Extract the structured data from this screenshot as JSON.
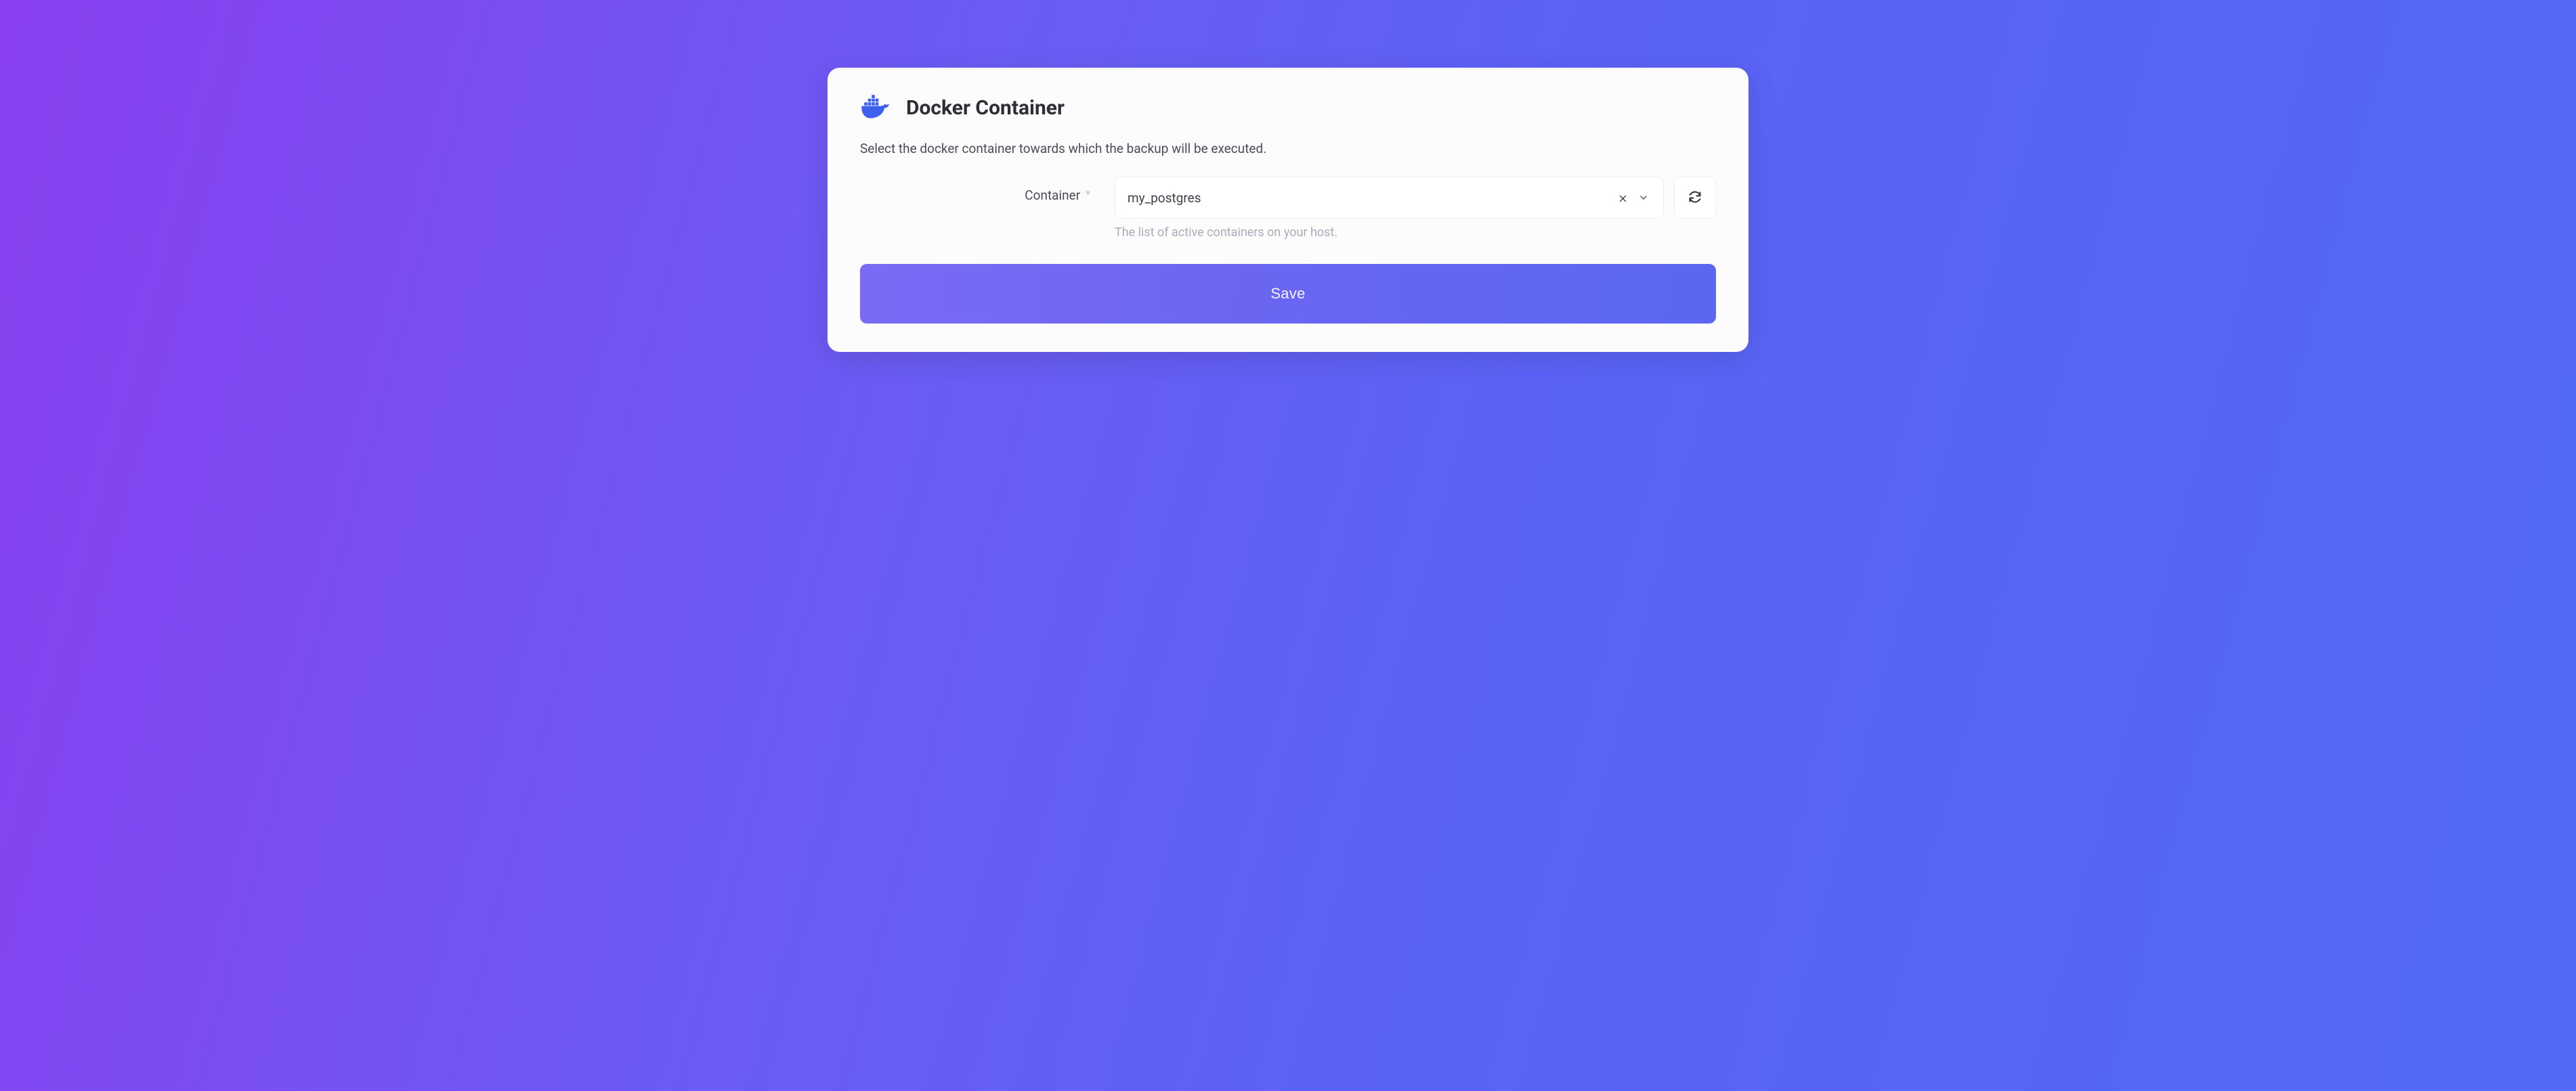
{
  "card": {
    "title": "Docker Container",
    "description": "Select the docker container towards which the backup will be executed."
  },
  "form": {
    "container": {
      "label": "Container",
      "required_mark": "*",
      "value": "my_postgres",
      "help_text": "The list of active containers on your host."
    },
    "save_label": "Save"
  }
}
